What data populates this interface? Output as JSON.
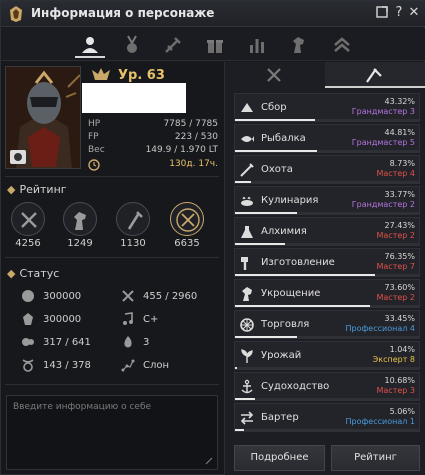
{
  "window": {
    "title": "Информация о персонаже"
  },
  "titlebar_buttons": [
    {
      "icon": "export-icon"
    },
    {
      "icon": "help-icon",
      "glyph": "?"
    },
    {
      "icon": "close-icon",
      "glyph": "✕"
    }
  ],
  "tabs": [
    {
      "icon": "profile-icon",
      "active": true
    },
    {
      "icon": "medal-icon",
      "active": false
    },
    {
      "icon": "skills-icon",
      "active": false
    },
    {
      "icon": "gift-icon",
      "active": false
    },
    {
      "icon": "stats-chart-icon",
      "active": false
    },
    {
      "icon": "horse-icon",
      "active": false
    },
    {
      "icon": "rank-chevron-icon",
      "active": false
    }
  ],
  "character": {
    "level": "Ур. 63",
    "stats": [
      {
        "k": "HP",
        "v": "7785 / 7785"
      },
      {
        "k": "FP",
        "v": "223 / 530"
      },
      {
        "k": "Вес",
        "v": "149.9 / 1.970 LT"
      },
      {
        "k": "",
        "v": "130д. 17ч."
      }
    ]
  },
  "rating_section": {
    "title": "Рейтинг",
    "items": [
      {
        "icon": "combat-icon",
        "value": "4256"
      },
      {
        "icon": "horse-icon",
        "value": "1249"
      },
      {
        "icon": "life-skill-icon",
        "value": "1130"
      },
      {
        "icon": "total-icon",
        "value": "6635"
      }
    ]
  },
  "status_section": {
    "title": "Статус",
    "rows": [
      {
        "icon": "energy-icon",
        "value": "300000"
      },
      {
        "icon": "contribution-icon",
        "value": "455 / 2960"
      },
      {
        "icon": "knowledge-icon",
        "value": "300000"
      },
      {
        "icon": "music-icon",
        "value": "C+"
      },
      {
        "icon": "skill-points-icon",
        "value": "317 / 641"
      },
      {
        "icon": "fire-icon",
        "value": "3"
      },
      {
        "icon": "zodiac-icon",
        "value": "143 / 378"
      },
      {
        "icon": "constellation-icon",
        "value": "Слон"
      }
    ]
  },
  "about": {
    "placeholder": "Введите информацию о себе"
  },
  "right_tabs": [
    {
      "icon": "crossed-swords-icon",
      "active": false
    },
    {
      "icon": "sickle-icon",
      "active": true
    }
  ],
  "life_skills": [
    {
      "icon": "gathering-icon",
      "name": "Сбор",
      "pct": "43.32%",
      "rank": "Грандмастер 3",
      "color": "#b574e0",
      "progress": 43.32
    },
    {
      "icon": "fishing-icon",
      "name": "Рыбалка",
      "pct": "44.81%",
      "rank": "Грандмастер 5",
      "color": "#b574e0",
      "progress": 44.81
    },
    {
      "icon": "hunting-icon",
      "name": "Охота",
      "pct": "8.73%",
      "rank": "Мастер 4",
      "color": "#e0504a",
      "progress": 8.73
    },
    {
      "icon": "cooking-icon",
      "name": "Кулинария",
      "pct": "33.77%",
      "rank": "Грандмастер 2",
      "color": "#b574e0",
      "progress": 33.77
    },
    {
      "icon": "alchemy-icon",
      "name": "Алхимия",
      "pct": "27.43%",
      "rank": "Мастер 2",
      "color": "#e0504a",
      "progress": 27.43
    },
    {
      "icon": "processing-icon",
      "name": "Изготовление",
      "pct": "76.35%",
      "rank": "Мастер 7",
      "color": "#e0504a",
      "progress": 76.35
    },
    {
      "icon": "training-icon",
      "name": "Укрощение",
      "pct": "73.60%",
      "rank": "Мастер 2",
      "color": "#e0504a",
      "progress": 73.6
    },
    {
      "icon": "trading-icon",
      "name": "Торговля",
      "pct": "33.45%",
      "rank": "Профессионал 4",
      "color": "#4a9bdc",
      "progress": 33.45
    },
    {
      "icon": "farming-icon",
      "name": "Урожай",
      "pct": "1.04%",
      "rank": "Эксперт 8",
      "color": "#e8c24a",
      "progress": 1.04
    },
    {
      "icon": "sailing-icon",
      "name": "Судоходство",
      "pct": "10.68%",
      "rank": "Мастер 3",
      "color": "#e0504a",
      "progress": 10.68
    },
    {
      "icon": "barter-icon",
      "name": "Бартер",
      "pct": "5.06%",
      "rank": "Профессионал 1",
      "color": "#4a9bdc",
      "progress": 5.06
    }
  ],
  "buttons": {
    "details": "Подробнее",
    "rating": "Рейтинг"
  },
  "colors": {
    "accent": "#c9a86a",
    "level": "#e8c26a",
    "bg": "#17181c"
  }
}
